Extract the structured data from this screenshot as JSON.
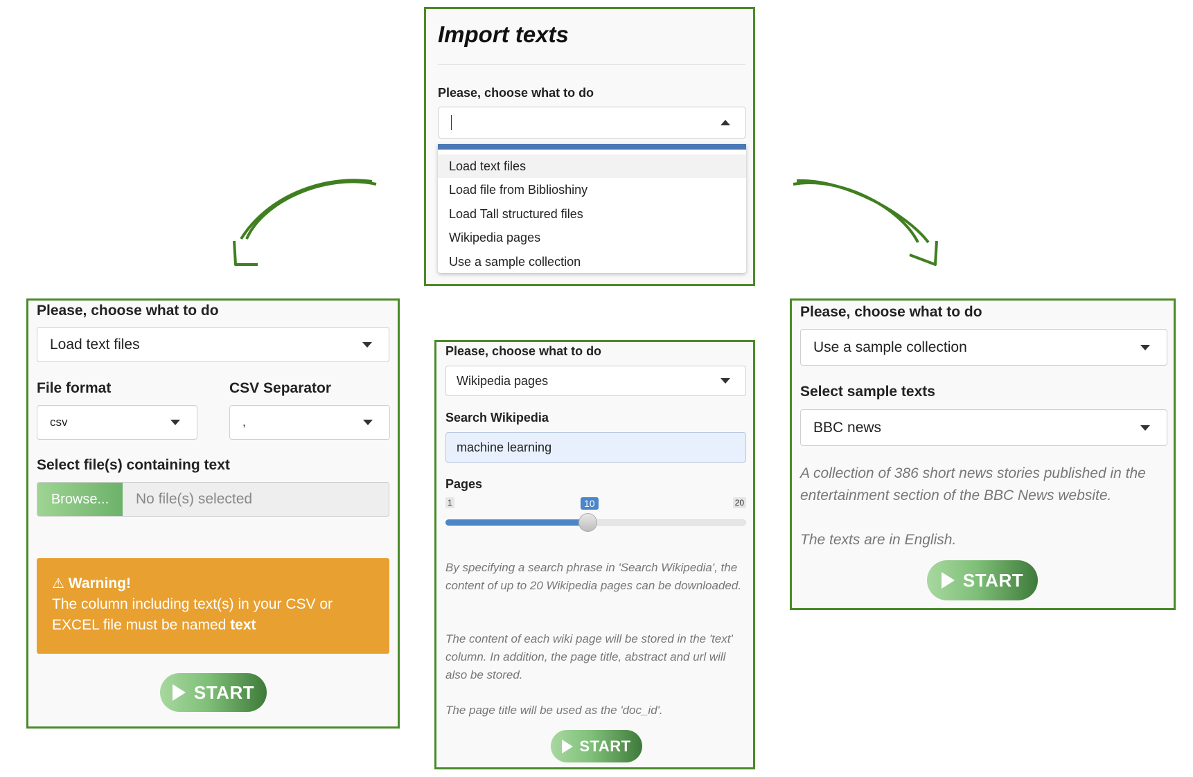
{
  "top": {
    "title": "Import texts",
    "choose_label": "Please, choose what to do",
    "menu_items": [
      "Load text files",
      "Load file from Biblioshiny",
      "Load Tall structured files",
      "Wikipedia pages",
      "Use a sample collection"
    ]
  },
  "left": {
    "choose_label": "Please, choose what to do",
    "selected": "Load text files",
    "file_format_label": "File format",
    "file_format_value": "csv",
    "csv_sep_label": "CSV Separator",
    "csv_sep_value": ",",
    "select_files_label": "Select file(s) containing text",
    "browse_label": "Browse...",
    "no_files": "No file(s) selected",
    "warning_title": "Warning!",
    "warning_text": "The column including text(s) in your CSV or EXCEL file must be named",
    "warning_bold": "text",
    "start_label": "START"
  },
  "middle": {
    "choose_label": "Please, choose what to do",
    "selected": "Wikipedia pages",
    "search_label": "Search Wikipedia",
    "search_value": "machine learning",
    "pages_label": "Pages",
    "slider_min": "1",
    "slider_max": "20",
    "slider_value": "10",
    "note1": "By specifying a search phrase in 'Search Wikipedia', the content of up to 20 Wikipedia pages can be downloaded.",
    "note2": "The content of each wiki page will be stored in the 'text' column. In addition, the page title, abstract and url will also be stored.",
    "note3": "The page title will be used as the 'doc_id'.",
    "start_label": "START"
  },
  "right": {
    "choose_label": "Please, choose what to do",
    "selected": "Use a sample collection",
    "sample_label": "Select sample texts",
    "sample_value": "BBC news",
    "desc1": "A collection of 386 short news stories published in the entertainment section of the BBC News website.",
    "desc2": "The texts are in English.",
    "start_label": "START"
  },
  "colors": {
    "panel_border": "#4a8a2a",
    "warning_bg": "#e8a030",
    "selected_bar": "#4a78b5",
    "slider_fill": "#4a86c8",
    "arrow": "#3f7f1f"
  }
}
